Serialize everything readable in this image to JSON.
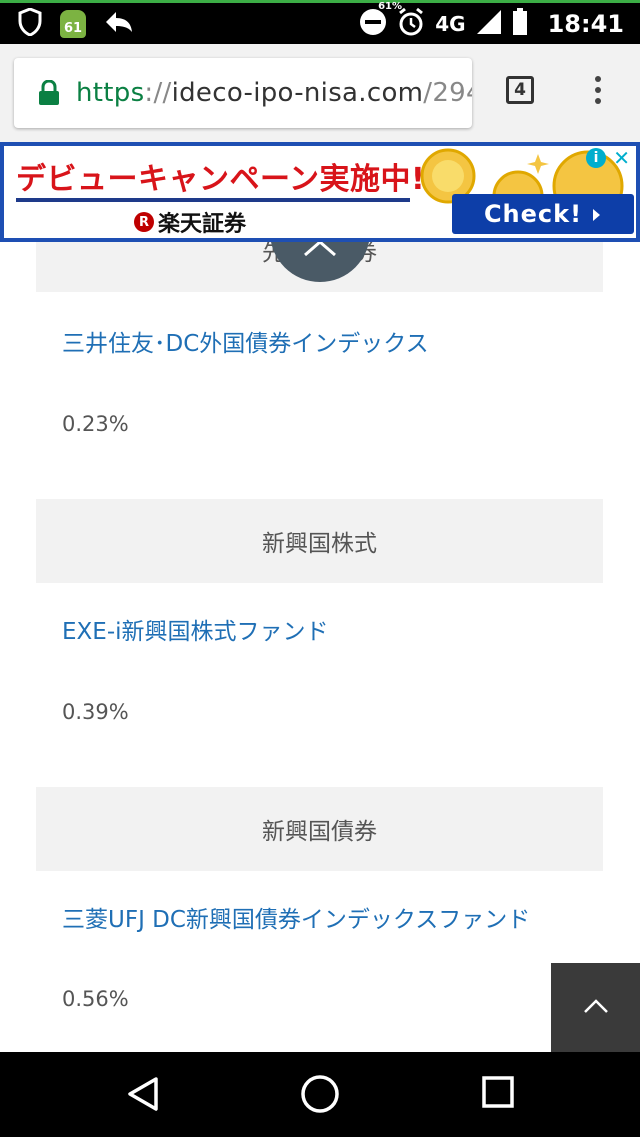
{
  "status_bar": {
    "notification_badge": "61",
    "battery_percent": "61%",
    "network": "4G",
    "time": "18:41",
    "icons": [
      "shield-icon",
      "android-update-icon",
      "reply-icon",
      "do-not-disturb-icon",
      "alarm-icon",
      "signal-icon",
      "battery-icon"
    ]
  },
  "browser": {
    "url_scheme": "https",
    "url_sep": "://",
    "url_host": "ideco-ipo-nisa.com",
    "url_path": "/294",
    "tab_count": "4"
  },
  "ad": {
    "headline": "デビューキャンペーン実施中!",
    "brand_mark": "R",
    "brand_name": "楽天証券",
    "cta": "Check!",
    "info_icon": "i",
    "close_icon": "✕"
  },
  "sections": [
    {
      "category": "先進国債券",
      "fund": "三井住友･DC外国債券インデックス",
      "fee": "0.23%"
    },
    {
      "category": "新興国株式",
      "fund": "EXE-i新興国株式ファンド",
      "fee": "0.39%"
    },
    {
      "category": "新興国債券",
      "fund": "三菱UFJ DC新興国債券インデックスファンド",
      "fee": "0.56%"
    }
  ],
  "colors": {
    "link": "#1f6fb5",
    "header_bg": "#f2f2f2",
    "ad_red": "#d8141a",
    "ad_blue": "#1e4fb3"
  }
}
